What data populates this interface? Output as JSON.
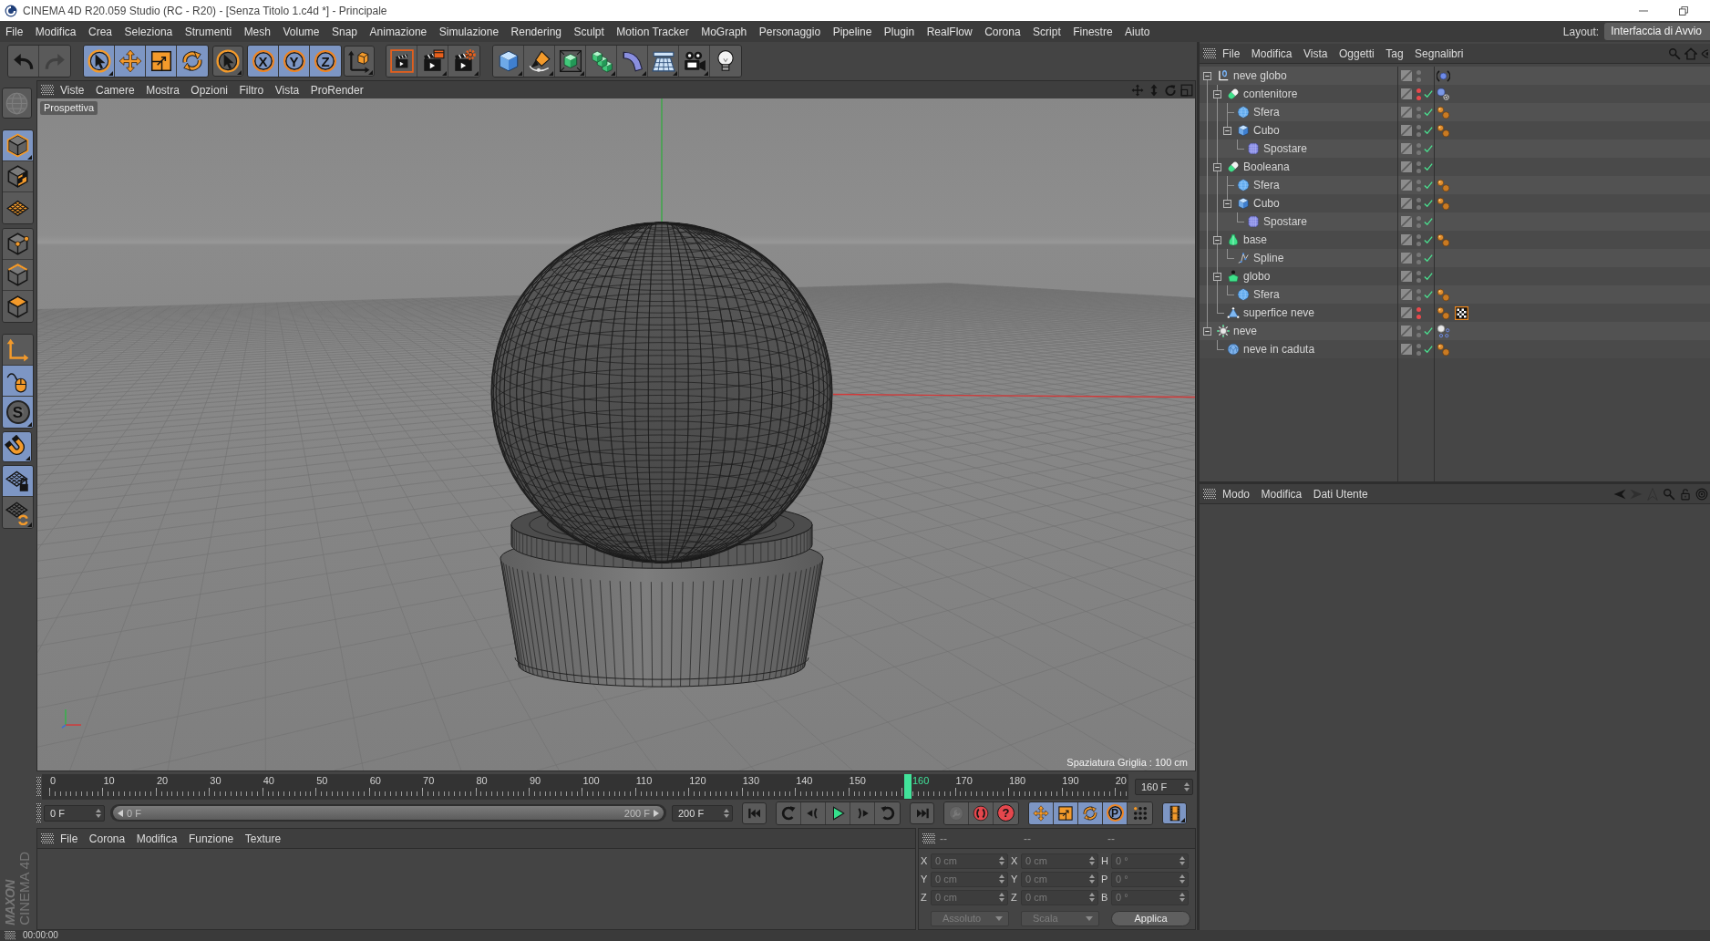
{
  "window": {
    "title": "CINEMA 4D R20.059 Studio (RC - R20) - [Senza Titolo 1.c4d *] - Principale"
  },
  "menu_bar": {
    "items": [
      "File",
      "Modifica",
      "Crea",
      "Seleziona",
      "Strumenti",
      "Mesh",
      "Volume",
      "Snap",
      "Animazione",
      "Simulazione",
      "Rendering",
      "Sculpt",
      "Motion Tracker",
      "MoGraph",
      "Personaggio",
      "Pipeline",
      "Plugin",
      "RealFlow",
      "Corona",
      "Script",
      "Finestre",
      "Aiuto"
    ],
    "layout_label": "Layout:",
    "layout_value": "Interfaccia di Avvio"
  },
  "toolbar": {
    "groups": [
      {
        "buttons": [
          {
            "kind": "undo",
            "selected": false,
            "disabled": false,
            "submenu": false
          },
          {
            "kind": "redo",
            "selected": false,
            "disabled": true,
            "submenu": false
          }
        ]
      },
      {
        "buttons": [
          {
            "kind": "select",
            "selected": true,
            "disabled": false,
            "submenu": true
          },
          {
            "kind": "move",
            "selected": true,
            "disabled": false,
            "submenu": false
          },
          {
            "kind": "scale",
            "selected": true,
            "disabled": false,
            "submenu": false
          },
          {
            "kind": "rotate",
            "selected": true,
            "disabled": false,
            "submenu": false
          }
        ]
      },
      {
        "buttons": [
          {
            "kind": "recent",
            "selected": false,
            "disabled": false,
            "submenu": true
          }
        ]
      },
      {
        "buttons": [
          {
            "kind": "axis",
            "label": "X",
            "selected": true,
            "disabled": false,
            "submenu": false
          },
          {
            "kind": "axis",
            "label": "Y",
            "selected": true,
            "disabled": false,
            "submenu": false
          },
          {
            "kind": "axis",
            "label": "Z",
            "selected": true,
            "disabled": false,
            "submenu": false
          }
        ]
      },
      {
        "buttons": [
          {
            "kind": "coords",
            "selected": false,
            "disabled": false,
            "submenu": true
          }
        ]
      },
      {
        "buttons": [
          {
            "kind": "renderview",
            "selected": false,
            "disabled": false,
            "submenu": false
          },
          {
            "kind": "renderpicture",
            "selected": false,
            "disabled": false,
            "submenu": true
          },
          {
            "kind": "rendersettings",
            "selected": false,
            "disabled": false,
            "submenu": true
          }
        ]
      },
      {
        "buttons": [
          {
            "kind": "cube",
            "selected": false,
            "disabled": false,
            "submenu": true
          },
          {
            "kind": "pen",
            "selected": false,
            "disabled": false,
            "submenu": true
          },
          {
            "kind": "subdivision",
            "selected": false,
            "disabled": false,
            "submenu": true
          },
          {
            "kind": "array",
            "selected": false,
            "disabled": false,
            "submenu": true
          },
          {
            "kind": "bend",
            "selected": false,
            "disabled": false,
            "submenu": true
          },
          {
            "kind": "floor",
            "selected": false,
            "disabled": false,
            "submenu": true
          },
          {
            "kind": "camera",
            "selected": false,
            "disabled": false,
            "submenu": true
          },
          {
            "kind": "light",
            "selected": false,
            "disabled": false,
            "submenu": false
          }
        ]
      }
    ]
  },
  "tools": {
    "groups": [
      {
        "buttons": [
          {
            "kind": "editable",
            "selected": false,
            "disabled": true,
            "submenu": false
          }
        ]
      },
      {
        "buttons": [
          {
            "kind": "model",
            "selected": true,
            "disabled": false,
            "submenu": true
          },
          {
            "kind": "texture",
            "selected": false,
            "disabled": false,
            "submenu": false
          },
          {
            "kind": "workplane",
            "selected": false,
            "disabled": false,
            "submenu": false
          }
        ]
      },
      {
        "buttons": [
          {
            "kind": "points",
            "selected": false,
            "disabled": false,
            "submenu": false
          },
          {
            "kind": "edges",
            "selected": false,
            "disabled": false,
            "submenu": false
          },
          {
            "kind": "polygons",
            "selected": false,
            "disabled": false,
            "submenu": false
          }
        ]
      },
      {
        "buttons": [
          {
            "kind": "axismode",
            "selected": false,
            "disabled": false,
            "submenu": false
          },
          {
            "kind": "tweak",
            "selected": true,
            "disabled": false,
            "submenu": false
          },
          {
            "kind": "solo",
            "label": "S",
            "selected": true,
            "disabled": false,
            "submenu": true
          }
        ]
      },
      {
        "buttons": [
          {
            "kind": "snap",
            "selected": true,
            "disabled": false,
            "submenu": true
          }
        ]
      },
      {
        "buttons": [
          {
            "kind": "gridlock",
            "selected": true,
            "disabled": false,
            "submenu": false
          },
          {
            "kind": "gridrotate",
            "selected": false,
            "disabled": false,
            "submenu": true
          }
        ]
      }
    ]
  },
  "viewport": {
    "menu": [
      "Viste",
      "Camere",
      "Mostra",
      "Opzioni",
      "Filtro",
      "Vista",
      "ProRender"
    ],
    "camera": "Prospettiva",
    "grid_spacing": "Spaziatura Griglia : 100 cm"
  },
  "object_manager": {
    "menu": [
      "File",
      "Modifica",
      "Vista",
      "Oggetti",
      "Tag",
      "Segnalibri"
    ],
    "objects": [
      {
        "name": "neve globo",
        "kind": "null",
        "expanded": true,
        "hidden_in_editor": false,
        "hidden_in_render": false,
        "enabled": false,
        "tags": [
          {
            "kind": "orb"
          }
        ],
        "children": [
          {
            "name": "contenitore",
            "kind": "boolean",
            "expanded": true,
            "hidden_in_editor": true,
            "hidden_in_render": true,
            "enabled": true,
            "tags": [
              {
                "kind": "orbgear"
              }
            ],
            "children": [
              {
                "name": "Sfera",
                "kind": "sphere",
                "hidden_in_editor": false,
                "hidden_in_render": false,
                "enabled": true,
                "tags": [
                  {
                    "kind": "phong"
                  }
                ]
              },
              {
                "name": "Cubo",
                "kind": "cube",
                "expanded": true,
                "hidden_in_editor": false,
                "hidden_in_render": false,
                "enabled": true,
                "tags": [
                  {
                    "kind": "phong"
                  }
                ],
                "children": [
                  {
                    "name": "Spostare",
                    "kind": "displacer",
                    "hidden_in_editor": false,
                    "hidden_in_render": false,
                    "enabled": true
                  }
                ]
              }
            ]
          },
          {
            "name": "Booleana",
            "kind": "boolean",
            "expanded": true,
            "hidden_in_editor": false,
            "hidden_in_render": false,
            "enabled": true,
            "children": [
              {
                "name": "Sfera",
                "kind": "sphere",
                "hidden_in_editor": false,
                "hidden_in_render": false,
                "enabled": true,
                "tags": [
                  {
                    "kind": "phong"
                  }
                ]
              },
              {
                "name": "Cubo",
                "kind": "cube",
                "expanded": true,
                "hidden_in_editor": false,
                "hidden_in_render": false,
                "enabled": true,
                "tags": [
                  {
                    "kind": "phong"
                  }
                ],
                "children": [
                  {
                    "name": "Spostare",
                    "kind": "displacer",
                    "hidden_in_editor": false,
                    "hidden_in_render": false,
                    "enabled": true
                  }
                ]
              }
            ]
          },
          {
            "name": "base",
            "kind": "lathe",
            "expanded": true,
            "hidden_in_editor": false,
            "hidden_in_render": false,
            "enabled": true,
            "tags": [
              {
                "kind": "phong"
              }
            ],
            "children": [
              {
                "name": "Spline",
                "kind": "spline",
                "hidden_in_editor": false,
                "hidden_in_render": false,
                "enabled": true
              }
            ]
          },
          {
            "name": "globo",
            "kind": "symmetry",
            "expanded": true,
            "hidden_in_editor": false,
            "hidden_in_render": false,
            "enabled": true,
            "children": [
              {
                "name": "Sfera",
                "kind": "sphere",
                "hidden_in_editor": false,
                "hidden_in_render": false,
                "enabled": true,
                "tags": [
                  {
                    "kind": "phong"
                  }
                ]
              }
            ]
          },
          {
            "name": "superfice neve",
            "kind": "polygon",
            "hidden_in_editor": true,
            "hidden_in_render": true,
            "enabled": false,
            "tags": [
              {
                "kind": "phong"
              },
              {
                "kind": "checker"
              }
            ]
          }
        ]
      },
      {
        "name": "neve",
        "kind": "emitter",
        "expanded": true,
        "hidden_in_editor": false,
        "hidden_in_render": false,
        "enabled": true,
        "tags": [
          {
            "kind": "orbdots"
          }
        ],
        "children": [
          {
            "name": "neve in caduta",
            "kind": "polyball",
            "hidden_in_editor": false,
            "hidden_in_render": false,
            "enabled": true,
            "tags": [
              {
                "kind": "phong"
              }
            ]
          }
        ]
      }
    ]
  },
  "attributes": {
    "menu": [
      "Modo",
      "Modifica",
      "Dati Utente"
    ],
    "nav": [
      {
        "kind": "back",
        "disabled": false
      },
      {
        "kind": "forward",
        "disabled": true
      },
      {
        "kind": "up",
        "disabled": true
      },
      {
        "kind": "search",
        "disabled": false
      },
      {
        "kind": "lock",
        "disabled": false
      },
      {
        "kind": "target",
        "disabled": false
      }
    ]
  },
  "timeline": {
    "ruler": [
      {
        "text": "0",
        "selected": false
      },
      {
        "text": "10",
        "selected": false
      },
      {
        "text": "20",
        "selected": false
      },
      {
        "text": "30",
        "selected": false
      },
      {
        "text": "40",
        "selected": false
      },
      {
        "text": "50",
        "selected": false
      },
      {
        "text": "60",
        "selected": false
      },
      {
        "text": "70",
        "selected": false
      },
      {
        "text": "80",
        "selected": false
      },
      {
        "text": "90",
        "selected": false
      },
      {
        "text": "100",
        "selected": false
      },
      {
        "text": "110",
        "selected": false
      },
      {
        "text": "120",
        "selected": false
      },
      {
        "text": "130",
        "selected": false
      },
      {
        "text": "140",
        "selected": false
      },
      {
        "text": "150",
        "selected": false
      },
      {
        "text": "160",
        "selected": true
      },
      {
        "text": "170",
        "selected": false
      },
      {
        "text": "180",
        "selected": false
      },
      {
        "text": "190",
        "selected": false
      },
      {
        "text": "20",
        "selected": false
      }
    ],
    "current_frame": "160 F",
    "start_frame": "0 F",
    "range": {
      "start": "0 F",
      "end": "200 F",
      "level": 1
    },
    "end_frame": "200 F",
    "groups": [
      {
        "buttons": [
          {
            "kind": "gostart",
            "selected": false,
            "disabled": false,
            "submenu": false
          }
        ]
      },
      {
        "buttons": [
          {
            "kind": "prevkey",
            "selected": false,
            "disabled": false,
            "submenu": false
          },
          {
            "kind": "prevframe",
            "selected": false,
            "disabled": false,
            "submenu": false
          },
          {
            "kind": "play",
            "selected": false,
            "disabled": false,
            "submenu": false
          },
          {
            "kind": "nextframe",
            "selected": false,
            "disabled": false,
            "submenu": false
          },
          {
            "kind": "nextkey",
            "selected": false,
            "disabled": false,
            "submenu": false
          }
        ]
      },
      {
        "buttons": [
          {
            "kind": "goend",
            "selected": false,
            "disabled": false,
            "submenu": false
          }
        ]
      },
      {
        "buttons": [
          {
            "kind": "keylock",
            "selected": false,
            "disabled": true,
            "submenu": false
          },
          {
            "kind": "record",
            "selected": false,
            "disabled": false,
            "submenu": false
          },
          {
            "kind": "autokey",
            "label": "?",
            "selected": false,
            "disabled": false,
            "submenu": false
          }
        ]
      },
      {
        "buttons": [
          {
            "kind": "keymove",
            "selected": true,
            "disabled": false,
            "submenu": false
          },
          {
            "kind": "keyscale",
            "selected": true,
            "disabled": false,
            "submenu": false
          },
          {
            "kind": "keyrotate",
            "selected": true,
            "disabled": false,
            "submenu": false
          },
          {
            "kind": "keyparam",
            "label": "P",
            "selected": true,
            "disabled": false,
            "submenu": false
          },
          {
            "kind": "keypoints",
            "selected": false,
            "disabled": false,
            "submenu": false
          }
        ]
      },
      {
        "buttons": [
          {
            "kind": "film",
            "selected": true,
            "disabled": false,
            "submenu": true
          }
        ]
      }
    ]
  },
  "material_manager": {
    "menu": [
      "File",
      "Corona",
      "Modifica",
      "Funzione",
      "Texture"
    ]
  },
  "coordinates": {
    "headers": [
      "--",
      "--",
      "--"
    ],
    "rows": [
      {
        "cells": [
          {
            "label": "X",
            "value": "0 cm",
            "disabled": true
          },
          {
            "label": "X",
            "value": "0 cm",
            "disabled": true
          },
          {
            "label": "H",
            "value": "0 °",
            "disabled": true
          }
        ]
      },
      {
        "cells": [
          {
            "label": "Y",
            "value": "0 cm",
            "disabled": true
          },
          {
            "label": "Y",
            "value": "0 cm",
            "disabled": true
          },
          {
            "label": "P",
            "value": "0 °",
            "disabled": true
          }
        ]
      },
      {
        "cells": [
          {
            "label": "Z",
            "value": "0 cm",
            "disabled": true
          },
          {
            "label": "Z",
            "value": "0 cm",
            "disabled": true
          },
          {
            "label": "B",
            "value": "0 °",
            "disabled": true
          }
        ]
      }
    ],
    "modes": [
      {
        "value": "Assoluto",
        "disabled": true
      },
      {
        "value": "Scala",
        "disabled": true
      }
    ],
    "apply": "Applica"
  },
  "status_bar": {
    "time": "00:00:00"
  },
  "logo": {
    "brand": "MAXON",
    "product": "CINEMA 4D"
  }
}
